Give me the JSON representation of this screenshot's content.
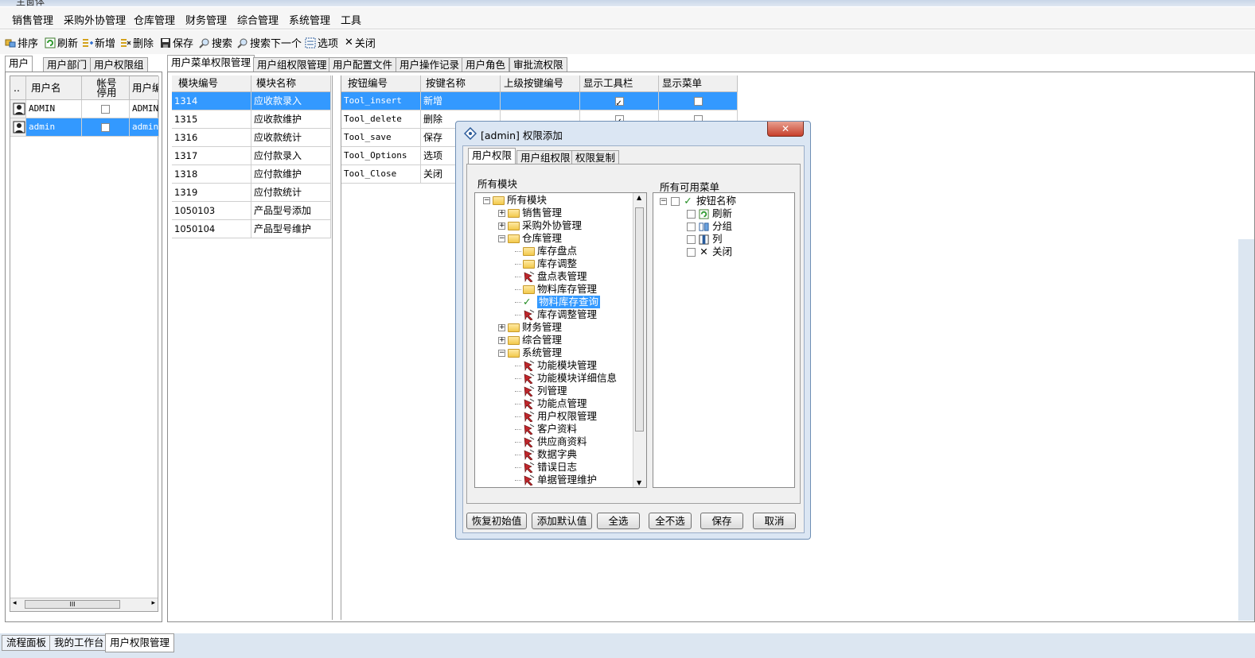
{
  "window": {
    "title": "主窗体"
  },
  "menu": [
    "销售管理",
    "采购外协管理",
    "仓库管理",
    "财务管理",
    "综合管理",
    "系统管理",
    "工具"
  ],
  "toolbar": [
    {
      "label": "排序",
      "icon": "sort-icon"
    },
    {
      "label": "刷新",
      "icon": "refresh-icon"
    },
    {
      "label": "新增",
      "icon": "add-icon"
    },
    {
      "label": "删除",
      "icon": "delete-icon"
    },
    {
      "label": "保存",
      "icon": "save-icon"
    },
    {
      "label": "搜索",
      "icon": "search-icon"
    },
    {
      "label": "搜索下一个",
      "icon": "search-next-icon"
    },
    {
      "label": "选项",
      "icon": "options-icon"
    },
    {
      "label": "关闭",
      "icon": "close-icon"
    }
  ],
  "left_tabs": [
    "用户",
    "用户部门",
    "用户权限组"
  ],
  "users": {
    "headers": [
      "..",
      "用户名",
      "帐号\n停用",
      "用户编"
    ],
    "rows": [
      {
        "name": "ADMIN",
        "disabled": false,
        "code": "ADMIN",
        "selected": false
      },
      {
        "name": "admin",
        "disabled": false,
        "code": "admin",
        "selected": true
      }
    ],
    "scroll_glyph": "III"
  },
  "main_tabs": [
    "用户菜单权限管理",
    "用户组权限管理",
    "用户配置文件",
    "用户操作记录",
    "用户角色",
    "审批流权限"
  ],
  "modules": {
    "headers": [
      "模块编号",
      "模块名称"
    ],
    "rows": [
      [
        "1314",
        "应收款录入"
      ],
      [
        "1315",
        "应收款维护"
      ],
      [
        "1316",
        "应收款统计"
      ],
      [
        "1317",
        "应付款录入"
      ],
      [
        "1318",
        "应付款维护"
      ],
      [
        "1319",
        "应付款统计"
      ],
      [
        "1050103",
        "产品型号添加"
      ],
      [
        "1050104",
        "产品型号维护"
      ]
    ]
  },
  "buttons_grid": {
    "headers": [
      "按钮编号",
      "按键名称",
      "上级按键编号",
      "显示工具栏",
      "显示菜单"
    ],
    "rows": [
      {
        "code": "Tool_insert",
        "name": "新增",
        "toolbar": true,
        "menu": false
      },
      {
        "code": "Tool_delete",
        "name": "删除",
        "toolbar": true,
        "menu": false
      },
      {
        "code": "Tool_save",
        "name": "保存",
        "toolbar": true,
        "menu": false
      },
      {
        "code": "Tool_Options",
        "name": "选项",
        "toolbar": true,
        "menu": false
      },
      {
        "code": "Tool_Close",
        "name": "关闭",
        "toolbar": true,
        "menu": false
      }
    ]
  },
  "dialog": {
    "title": "[admin] 权限添加",
    "close_glyph": "✕",
    "tabs": [
      "用户权限",
      "用户组权限",
      "权限复制"
    ],
    "left_label": "所有模块",
    "right_label": "所有可用菜单",
    "tree": [
      {
        "label": "所有模块",
        "level": 0,
        "type": "folder",
        "expander": "-"
      },
      {
        "label": "销售管理",
        "level": 1,
        "type": "folder",
        "expander": "+"
      },
      {
        "label": "采购外协管理",
        "level": 1,
        "type": "folder",
        "expander": "+"
      },
      {
        "label": "仓库管理",
        "level": 1,
        "type": "folder",
        "expander": "-"
      },
      {
        "label": "库存盘点",
        "level": 2,
        "type": "folder"
      },
      {
        "label": "库存调整",
        "level": 2,
        "type": "folder"
      },
      {
        "label": "盘点表管理",
        "level": 2,
        "type": "leaf"
      },
      {
        "label": "物料库存管理",
        "level": 2,
        "type": "folder"
      },
      {
        "label": "物料库存查询",
        "level": 2,
        "type": "check",
        "selected": true
      },
      {
        "label": "库存调整管理",
        "level": 2,
        "type": "leaf"
      },
      {
        "label": "财务管理",
        "level": 1,
        "type": "folder",
        "expander": "+"
      },
      {
        "label": "综合管理",
        "level": 1,
        "type": "folder",
        "expander": "+"
      },
      {
        "label": "系统管理",
        "level": 1,
        "type": "folder",
        "expander": "-"
      },
      {
        "label": "功能模块管理",
        "level": 2,
        "type": "leaf"
      },
      {
        "label": "功能模块详细信息",
        "level": 2,
        "type": "leaf"
      },
      {
        "label": "列管理",
        "level": 2,
        "type": "leaf"
      },
      {
        "label": "功能点管理",
        "level": 2,
        "type": "leaf"
      },
      {
        "label": "用户权限管理",
        "level": 2,
        "type": "leaf"
      },
      {
        "label": "客户资料",
        "level": 2,
        "type": "leaf"
      },
      {
        "label": "供应商资料",
        "level": 2,
        "type": "leaf"
      },
      {
        "label": "数据字典",
        "level": 2,
        "type": "leaf"
      },
      {
        "label": "错误日志",
        "level": 2,
        "type": "leaf"
      },
      {
        "label": "单据管理维护",
        "level": 2,
        "type": "leaf"
      }
    ],
    "menu_tree": [
      {
        "label": "按钮名称",
        "level": 0,
        "icon": "check-icon",
        "expander": "-"
      },
      {
        "label": "刷新",
        "level": 1,
        "icon": "refresh-icon"
      },
      {
        "label": "分组",
        "level": 1,
        "icon": "group-icon"
      },
      {
        "label": "列",
        "level": 1,
        "icon": "column-icon"
      },
      {
        "label": "关闭",
        "level": 1,
        "icon": "close-icon"
      }
    ],
    "buttons": [
      "恢复初始值",
      "添加默认值",
      "全选",
      "全不选",
      "保存",
      "取消"
    ]
  },
  "bottom_tabs": [
    "流程面板",
    "我的工作台",
    "用户权限管理"
  ],
  "colors": {
    "selection": "#3399ff",
    "dialog_frame": "#dbe6f3",
    "statusbar": "#dce6f1"
  }
}
